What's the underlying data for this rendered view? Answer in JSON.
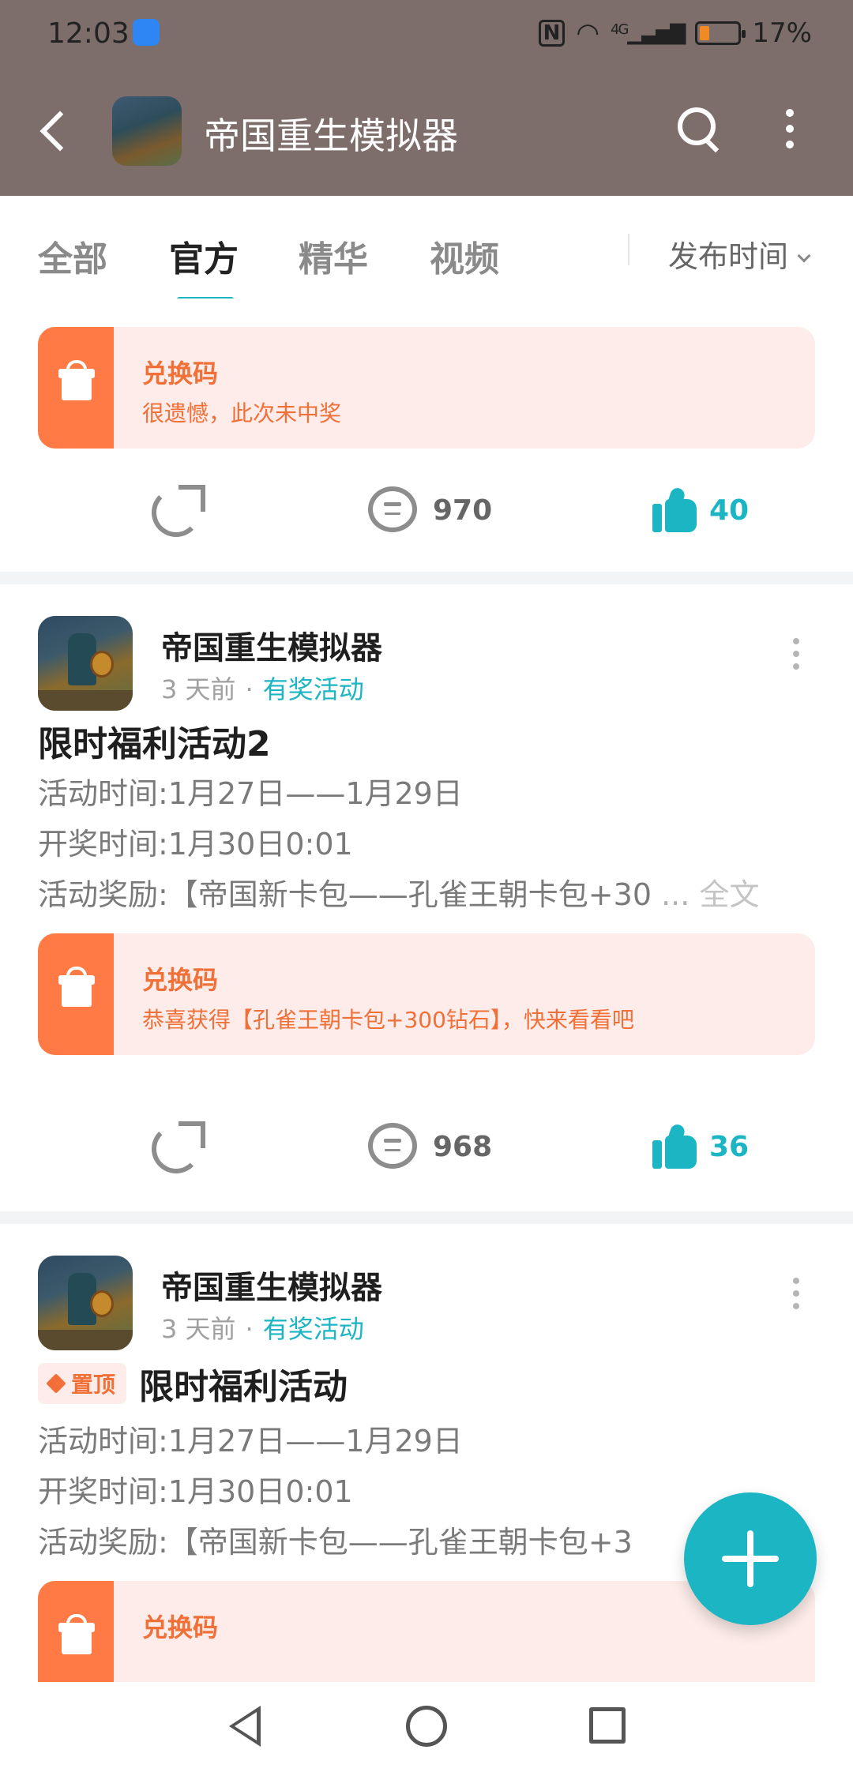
{
  "status_bar": {
    "time": "12:03",
    "battery": "17%",
    "network": "4G"
  },
  "header": {
    "title": "帝国重生模拟器"
  },
  "tabs": {
    "items": [
      "全部",
      "官方",
      "精华",
      "视频"
    ],
    "active_index": 1,
    "sort_label": "发布时间"
  },
  "posts": [
    {
      "prize": {
        "title": "兑换码",
        "desc": "很遗憾，此次未中奖"
      },
      "comments": "970",
      "likes": "40"
    },
    {
      "author": "帝国重生模拟器",
      "time": "3 天前",
      "tag": "有奖活动",
      "title": "限时福利活动2",
      "lines": [
        "活动时间:1月27日——1月29日",
        "开奖时间:1月30日0:01",
        "活动奖励:【帝国新卡包——孔雀王朝卡包+30"
      ],
      "ellipsis": "...",
      "full_text": "全文",
      "prize": {
        "title": "兑换码",
        "desc": "恭喜获得【孔雀王朝卡包+300钻石】，快来看看吧"
      },
      "comments": "968",
      "likes": "36"
    },
    {
      "author": "帝国重生模拟器",
      "time": "3 天前",
      "tag": "有奖活动",
      "pin_label": "置顶",
      "title": "限时福利活动",
      "lines": [
        "活动时间:1月27日——1月29日",
        "开奖时间:1月30日0:01",
        "活动奖励:【帝国新卡包——孔雀王朝卡包+3"
      ],
      "prize": {
        "title": "兑换码"
      }
    }
  ],
  "colors": {
    "accent": "#1bb5c4",
    "prize_orange": "#ff7a45",
    "header_bg": "#7d6e6b"
  }
}
